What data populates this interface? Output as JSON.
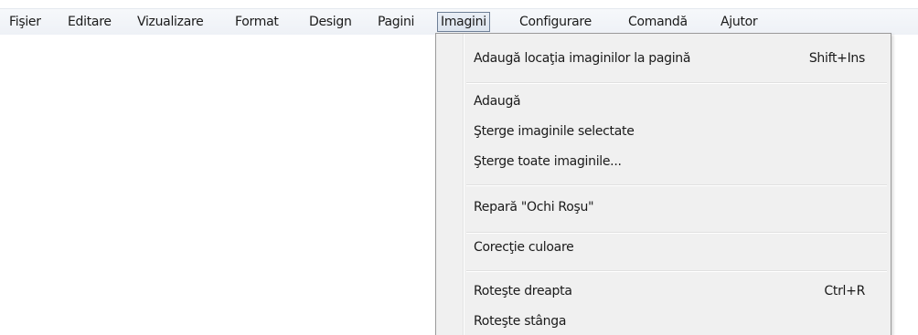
{
  "menubar": {
    "items": [
      {
        "label": "Fişier"
      },
      {
        "label": "Editare"
      },
      {
        "label": "Vizualizare"
      },
      {
        "label": "Format"
      },
      {
        "label": "Design"
      },
      {
        "label": "Pagini"
      },
      {
        "label": "Imagini"
      },
      {
        "label": "Configurare"
      },
      {
        "label": "Comandă"
      },
      {
        "label": "Ajutor"
      }
    ]
  },
  "imagini_menu": {
    "items": [
      {
        "label": "Adaugă locaţia imaginilor la pagină",
        "shortcut": "Shift+Ins"
      },
      {
        "label": "Adaugă"
      },
      {
        "label": "Şterge imaginile selectate"
      },
      {
        "label": "Şterge toate imaginile..."
      },
      {
        "label": "Repară \"Ochi Roşu\""
      },
      {
        "label": "Corecţie culoare"
      },
      {
        "label": "Roteşte dreapta",
        "shortcut": "Ctrl+R"
      },
      {
        "label": "Roteşte stânga"
      }
    ]
  }
}
